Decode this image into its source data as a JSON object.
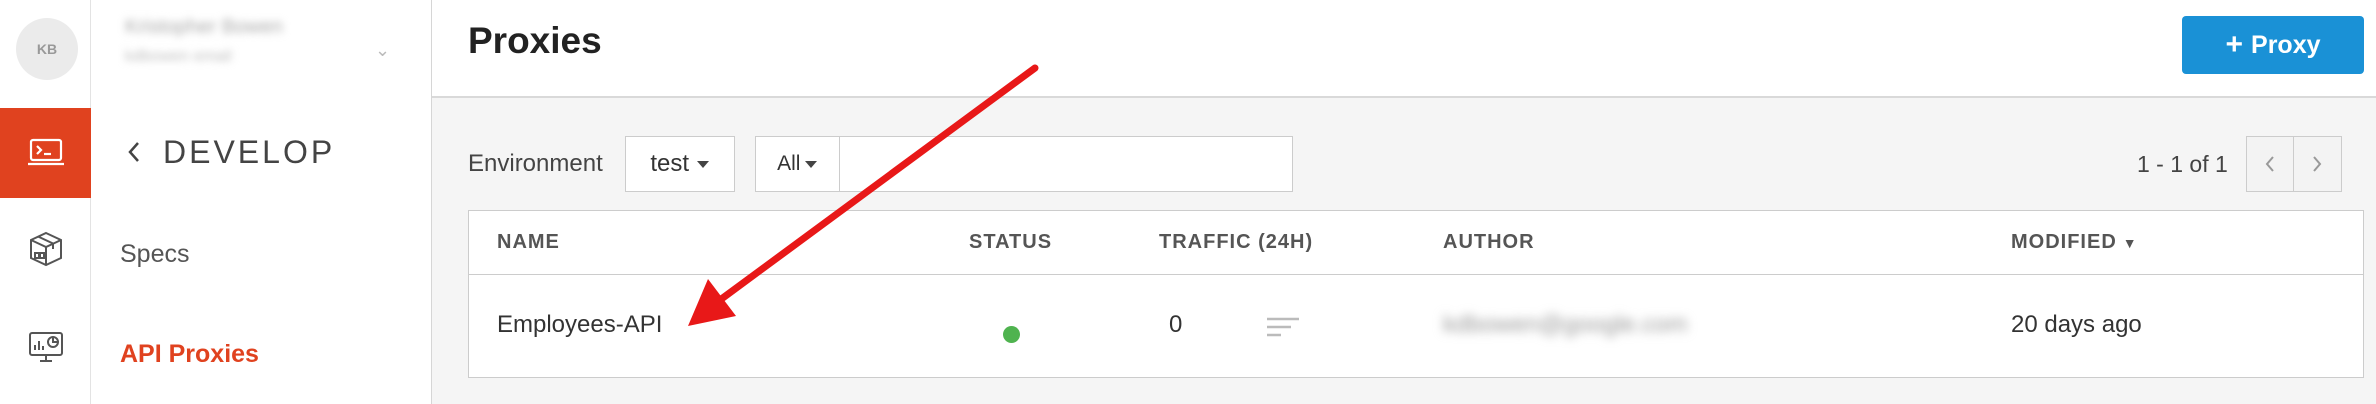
{
  "rail": {
    "avatar_initials": "KB",
    "items": [
      {
        "name": "develop",
        "icon": "terminal-icon",
        "active": true
      },
      {
        "name": "publish",
        "icon": "packages-icon",
        "active": false
      },
      {
        "name": "analyze",
        "icon": "analytics-icon",
        "active": false
      }
    ],
    "active_color": "#e0421f"
  },
  "nav": {
    "user_name": "Kristopher Bowen",
    "user_email": "kdbowen email",
    "section_title": "DEVELOP",
    "links": [
      {
        "label": "Specs",
        "active": false
      },
      {
        "label": "API Proxies",
        "active": true
      }
    ]
  },
  "page": {
    "title": "Proxies",
    "add_button_label": "Proxy"
  },
  "filters": {
    "environment_label": "Environment",
    "environment_value": "test",
    "scope_value": "All",
    "search_value": ""
  },
  "pagination": {
    "text": "1 - 1 of 1"
  },
  "table": {
    "columns": [
      "NAME",
      "STATUS",
      "TRAFFIC (24H)",
      "AUTHOR",
      "MODIFIED"
    ],
    "sorted_column": "MODIFIED",
    "rows": [
      {
        "name": "Employees-API",
        "status": "deployed",
        "traffic": "0",
        "author": "kdbowen@google.com",
        "modified": "20 days ago"
      }
    ]
  },
  "colors": {
    "accent": "#1a91d6",
    "brand": "#e0421f",
    "status_ok": "#4fb34f",
    "annotation": "#e81818"
  }
}
